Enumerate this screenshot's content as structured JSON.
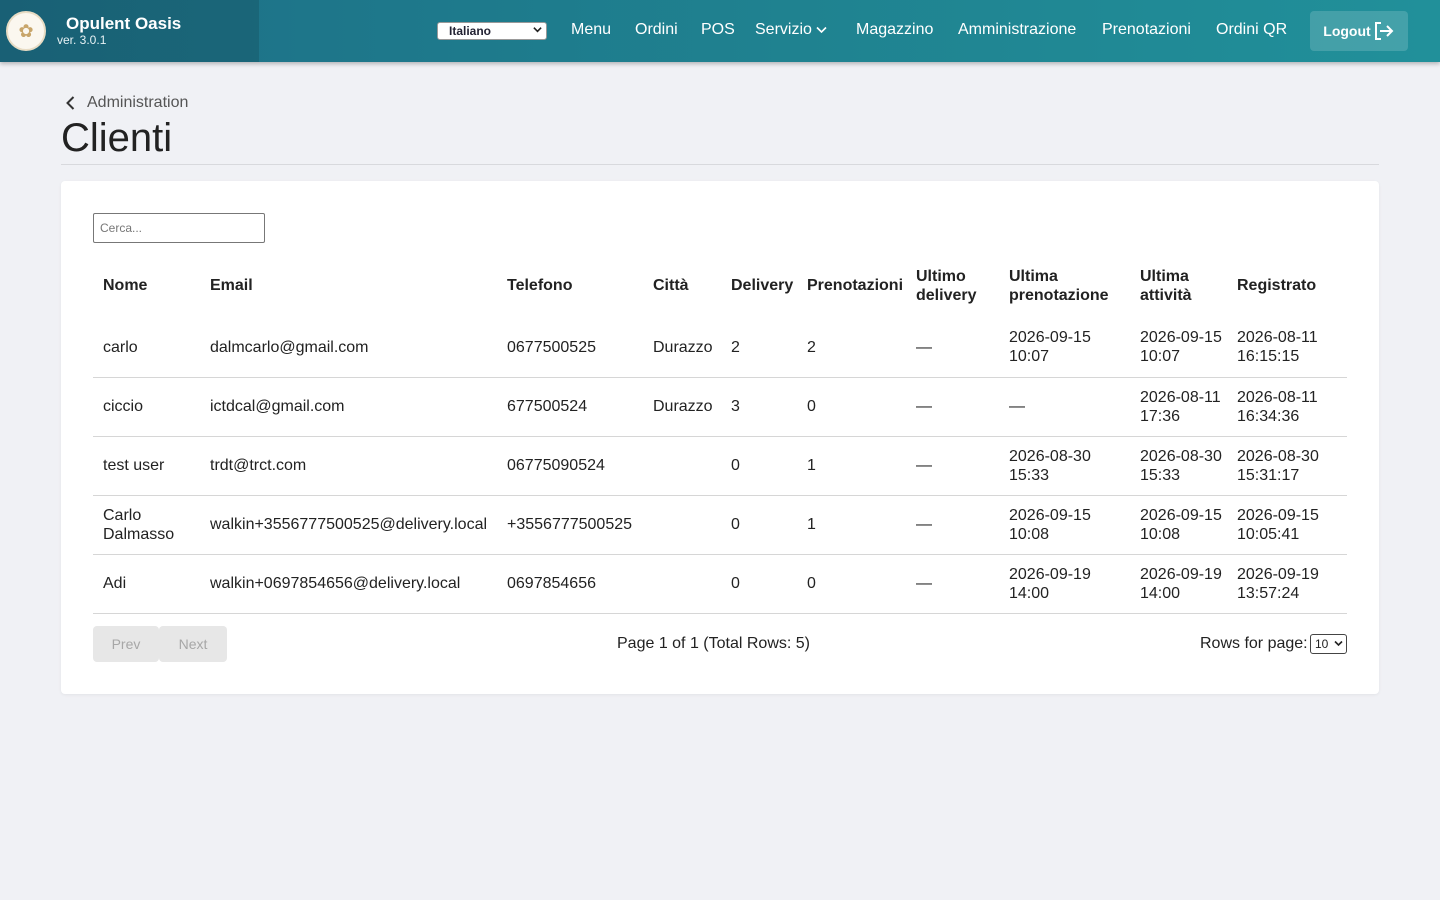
{
  "app": {
    "name": "Opulent Oasis",
    "version": "ver. 3.0.1",
    "logo_icon": "lotus-logo-icon"
  },
  "language": {
    "selected": "Italiano"
  },
  "nav": {
    "items": [
      "Menu",
      "Ordini",
      "POS",
      "Servizio",
      "Magazzino",
      "Amministrazione",
      "Prenotazioni",
      "Ordini QR"
    ],
    "logout": "Logout"
  },
  "breadcrumb": {
    "parent": "Administration"
  },
  "page": {
    "title": "Clienti"
  },
  "search": {
    "placeholder": "Cerca..."
  },
  "table": {
    "columns": [
      "Nome",
      "Email",
      "Telefono",
      "Città",
      "Delivery",
      "Prenotazioni",
      "Ultimo delivery",
      "Ultima prenotazione",
      "Ultima attività",
      "Registrato"
    ],
    "rows": [
      [
        "carlo",
        "dalmcarlo@gmail.com",
        "0677500525",
        "Durazzo",
        "2",
        "2",
        "—",
        "2026-09-15 10:07",
        "2026-09-15 10:07",
        "2026-08-11 16:15:15"
      ],
      [
        "ciccio",
        "ictdcal@gmail.com",
        "677500524",
        "Durazzo",
        "3",
        "0",
        "—",
        "—",
        "2026-08-11 17:36",
        "2026-08-11 16:34:36"
      ],
      [
        "test user",
        "trdt@trct.com",
        "06775090524",
        "",
        "0",
        "1",
        "—",
        "2026-08-30 15:33",
        "2026-08-30 15:33",
        "2026-08-30 15:31:17"
      ],
      [
        "Carlo Dalmasso",
        "walkin+3556777500525@delivery.local",
        "+3556777500525",
        "",
        "0",
        "1",
        "—",
        "2026-09-15 10:08",
        "2026-09-15 10:08",
        "2026-09-15 10:05:41"
      ],
      [
        "Adi",
        "walkin+0697854656@delivery.local",
        "0697854656",
        "",
        "0",
        "0",
        "—",
        "2026-09-19 14:00",
        "2026-09-19 14:00",
        "2026-09-19 13:57:24"
      ]
    ]
  },
  "pagination": {
    "prev": "Prev",
    "next": "Next",
    "info": "Page 1 of 1 (Total Rows: 5)",
    "rows_label": "Rows for page:",
    "rows_value": "10"
  }
}
